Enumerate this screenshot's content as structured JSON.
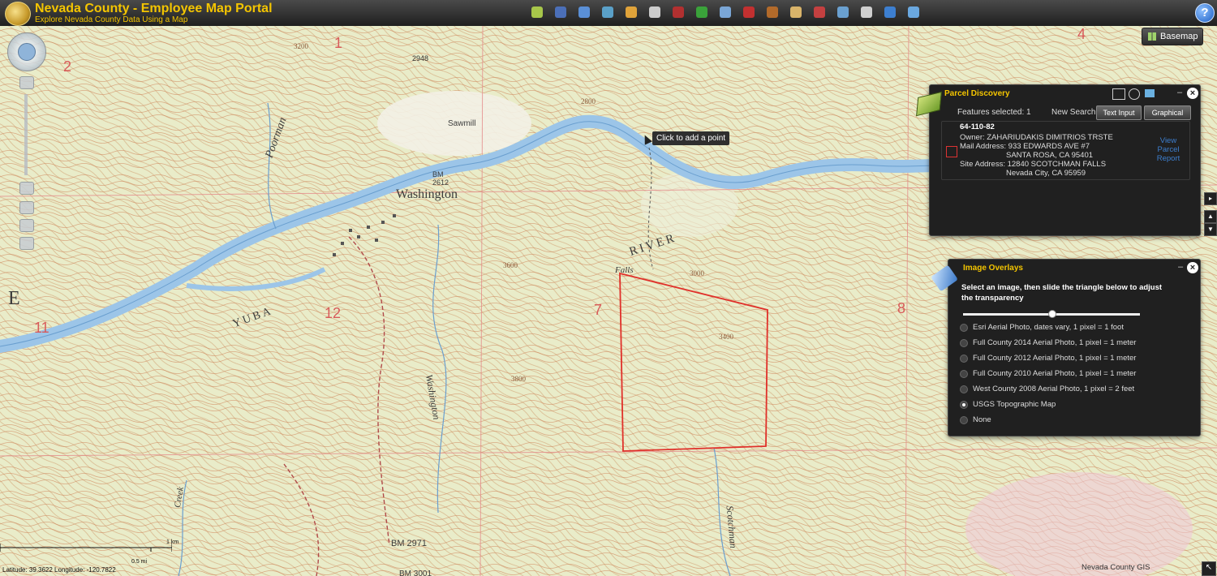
{
  "app": {
    "title": "Nevada County - Employee Map Portal",
    "subtitle": "Explore Nevada County Data Using a Map"
  },
  "toolbar": [
    {
      "icon": "layers-leaf-icon",
      "color": "#a7c64a"
    },
    {
      "icon": "grid-overview-icon",
      "color": "#4b6fb8"
    },
    {
      "icon": "measure-icon",
      "color": "#5a8fd6"
    },
    {
      "icon": "layer-stack-icon",
      "color": "#5aa0c8"
    },
    {
      "icon": "torch-icon",
      "color": "#e0a33a"
    },
    {
      "icon": "person-icon",
      "color": "#cccccc"
    },
    {
      "icon": "bug-icon",
      "color": "#b23030"
    },
    {
      "icon": "tree-icon",
      "color": "#3aa23a"
    },
    {
      "icon": "boxes-icon",
      "color": "#7aa6d6"
    },
    {
      "icon": "firetruck-icon",
      "color": "#c23030"
    },
    {
      "icon": "boot-icon",
      "color": "#b26a2a"
    },
    {
      "icon": "palette-icon",
      "color": "#d9b46a"
    },
    {
      "icon": "book-icon",
      "color": "#c44040"
    },
    {
      "icon": "monitor-icon",
      "color": "#6aa0d0"
    },
    {
      "icon": "printer-icon",
      "color": "#cfcfcf"
    },
    {
      "icon": "tools-icon",
      "color": "#3d7fd0"
    },
    {
      "icon": "satellite-icon",
      "color": "#6aa8e0"
    }
  ],
  "help_label": "?",
  "basemap_label": "Basemap",
  "tooltip": "Click to add a point",
  "map_labels": {
    "washington": "Washington",
    "sawmill": "Sawmill",
    "bm_2612": "BM\n2612",
    "river": "RIVER",
    "yuba": "YUBA",
    "poorman": "Poorman",
    "washington_creek": "Washington",
    "scotchman": "Scotchman",
    "creek": "Creek",
    "falls": "Falls",
    "bm_2971": "BM 2971",
    "bm_3001": "BM 3001",
    "e_label": "E",
    "elev_3200": "3200",
    "elev_2948": "2948",
    "elev_2800": "2800",
    "elev_3600": "3600",
    "elev_3800": "3800",
    "elev_3400": "3400",
    "elev_3000": "3000",
    "sec_1": "1",
    "sec_2": "2",
    "sec_4": "4",
    "sec_7": "7",
    "sec_8": "8",
    "sec_11": "11",
    "sec_12": "12"
  },
  "parcel_discovery": {
    "title": "Parcel Discovery",
    "features_selected": "Features selected: 1",
    "new_search": "New Search:",
    "btn_text_input": "Text Input",
    "btn_graphical": "Graphical",
    "apn": "64-110-82",
    "owner": "Owner: ZAHARIUDAKIS DIMITRIOS TRSTE",
    "mail_address": "Mail Address: 933 EDWARDS AVE #7",
    "mail_city": "SANTA ROSA, CA  95401",
    "site_address": "Site Address: 12840 SCOTCHMAN FALLS",
    "site_city": "Nevada City, CA 95959",
    "report_link": "View\nParcel\nReport"
  },
  "image_overlays": {
    "title": "Image Overlays",
    "instructions": "Select an image, then slide the triangle below to adjust the transparency",
    "transparency": 0.5,
    "options": [
      {
        "label": "Esri Aerial Photo, dates vary, 1 pixel = 1 foot",
        "selected": false
      },
      {
        "label": "Full County 2014 Aerial Photo, 1 pixel = 1 meter",
        "selected": false
      },
      {
        "label": "Full County 2012 Aerial Photo, 1 pixel = 1 meter",
        "selected": false
      },
      {
        "label": "Full County 2010 Aerial Photo, 1 pixel = 1 meter",
        "selected": false
      },
      {
        "label": "West County 2008 Aerial Photo, 1 pixel = 2 feet",
        "selected": false
      },
      {
        "label": "USGS Topographic Map",
        "selected": true
      },
      {
        "label": "None",
        "selected": false
      }
    ]
  },
  "scale": {
    "km_label": "1 km",
    "mi_label": "0.5 mi"
  },
  "coords": "Latitude: 39.3622   Longitude: -120.7822",
  "attribution": "Nevada County GIS",
  "colors": {
    "accent_yellow": "#f4c500",
    "parcel_outline": "#e0302a",
    "river": "#9cc5e8",
    "contour": "#c98a5a"
  }
}
